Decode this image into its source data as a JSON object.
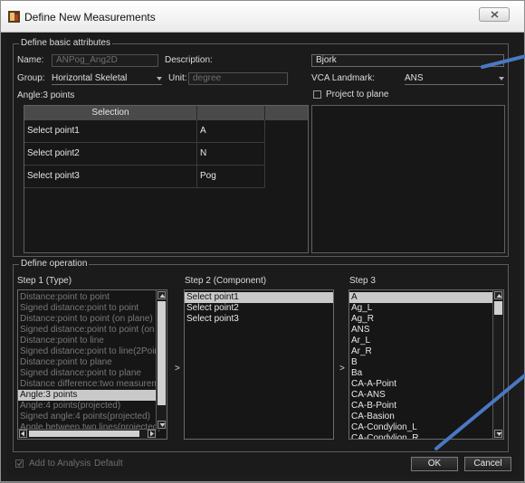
{
  "window": {
    "title": "Define New Measurements"
  },
  "basic": {
    "group_title": "Define basic attributes",
    "name_label": "Name:",
    "name_value": "ANPog_Ang2D",
    "description_label": "Description:",
    "description_value": "Bjork",
    "group_label": "Group:",
    "group_value": "Horizontal Skeletal",
    "unit_label": "Unit:",
    "unit_value": "degree",
    "vca_label": "VCA Landmark:",
    "vca_value": "ANS",
    "project_label": "Project to plane",
    "angle_label": "Angle:3 points",
    "table": {
      "header": "Selection",
      "rows": [
        {
          "selection": "Select point1",
          "value": "A"
        },
        {
          "selection": "Select point2",
          "value": "N"
        },
        {
          "selection": "Select point3",
          "value": "Pog"
        }
      ]
    }
  },
  "operation": {
    "group_title": "Define operation",
    "step1_label": "Step 1 (Type)",
    "step2_label": "Step 2 (Component)",
    "step3_label": "Step 3",
    "step1_items": [
      {
        "text": "Distance:point to point",
        "state": "off"
      },
      {
        "text": "Signed distance:point to point",
        "state": "off"
      },
      {
        "text": "Distance:point to point (on plane)",
        "state": "off"
      },
      {
        "text": "Signed distance:point to point (on pla",
        "state": "off"
      },
      {
        "text": "Distance:point to line",
        "state": "off"
      },
      {
        "text": "Signed distance:point to line(2Points)",
        "state": "off"
      },
      {
        "text": "Distance:point to plane",
        "state": "off"
      },
      {
        "text": "Signed distance:point to plane",
        "state": "off"
      },
      {
        "text": "Distance difference:two measuremen",
        "state": "off"
      },
      {
        "text": "Angle:3 points",
        "state": "sel"
      },
      {
        "text": "Angle:4 points(projected)",
        "state": "off"
      },
      {
        "text": "Signed angle:4 points(projected)",
        "state": "off"
      },
      {
        "text": "Angle between two lines(projected)",
        "state": "off"
      }
    ],
    "step2_items": [
      {
        "text": "Select point1",
        "state": "sel"
      },
      {
        "text": "Select point2",
        "state": "on"
      },
      {
        "text": "Select point3",
        "state": "on"
      }
    ],
    "step3_items": [
      {
        "text": "A",
        "state": "sel"
      },
      {
        "text": "Ag_L",
        "state": "on"
      },
      {
        "text": "Ag_R",
        "state": "on"
      },
      {
        "text": "ANS",
        "state": "on"
      },
      {
        "text": "Ar_L",
        "state": "on"
      },
      {
        "text": "Ar_R",
        "state": "on"
      },
      {
        "text": "B",
        "state": "on"
      },
      {
        "text": "Ba",
        "state": "on"
      },
      {
        "text": "CA-A-Point",
        "state": "on"
      },
      {
        "text": "CA-ANS",
        "state": "on"
      },
      {
        "text": "CA-B-Point",
        "state": "on"
      },
      {
        "text": "CA-Basion",
        "state": "on"
      },
      {
        "text": "CA-Condylion_L",
        "state": "on"
      },
      {
        "text": "CA-Condylion_R",
        "state": "on"
      }
    ],
    "arrow1": ">",
    "arrow2": ">"
  },
  "footer": {
    "add_label": "Add to Analysis",
    "default_label": "Default",
    "ok_label": "OK",
    "cancel_label": "Cancel"
  },
  "colors": {
    "annotation_line": "#4a78c2",
    "selection_bg": "#c9c9c9",
    "window_bg": "#1b1b1b"
  }
}
